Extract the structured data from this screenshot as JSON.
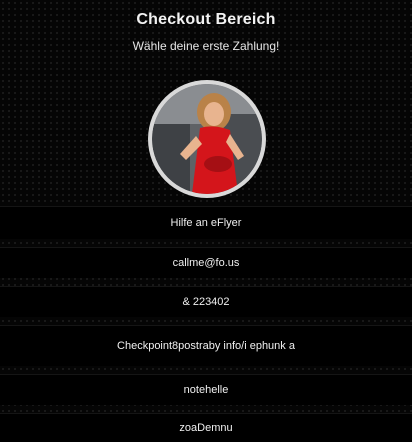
{
  "header": {
    "title": "Checkout Bereich",
    "subtitle": "Wähle deine erste Zahlung!"
  },
  "profile": {
    "avatar_icon": "profile-photo-icon",
    "colors": {
      "dress": "#d4151b",
      "skin": "#e8b48f",
      "hair": "#b98248",
      "background": "#6c6f73",
      "ring": "#d9d9d9"
    }
  },
  "rows": [
    {
      "label": "Hilfe an eFlyer"
    },
    {
      "label": "callme@fo.us"
    },
    {
      "label": "& 223402"
    },
    {
      "label": "Checkpoint8postraby info/i ephunk a"
    },
    {
      "label": "notehelle"
    },
    {
      "label": "zoaDemnu"
    }
  ]
}
